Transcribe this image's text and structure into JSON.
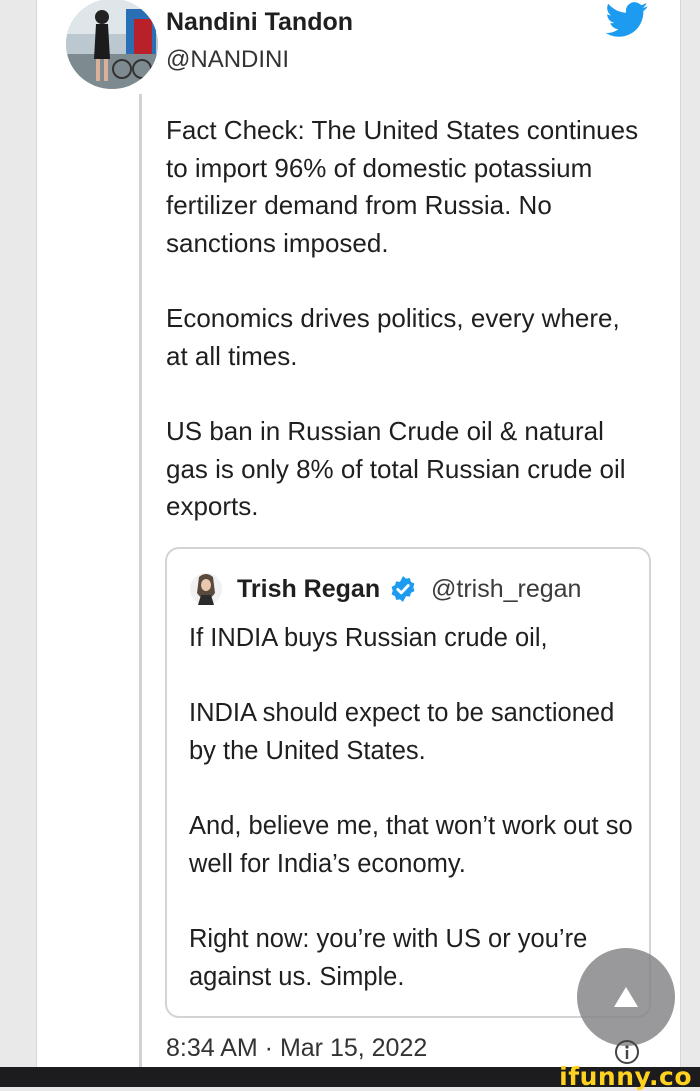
{
  "tweet": {
    "author_name": "Nandini Tandon",
    "author_handle": "@NANDINI",
    "paragraphs": [
      "Fact Check: The United States continues to import 96% of domestic potassium fertilizer demand from Russia. No sanctions imposed.",
      "Economics drives politics, every where, at all times.",
      "US ban in Russian Crude oil & natural gas is only 8% of total Russian crude oil exports."
    ],
    "timestamp": "8:34 AM · Mar 15, 2022"
  },
  "quoted_tweet": {
    "author_name": "Trish Regan",
    "author_handle": "@trish_regan",
    "paragraphs": [
      "If INDIA buys Russian crude oil,",
      "INDIA should expect to be sanctioned by the United States.",
      "And, believe me, that won’t work out so well for India’s economy.",
      "Right now: you’re with US or you’re against us. Simple."
    ]
  },
  "icons": {
    "brand": "twitter-bird-icon",
    "verified": "verified-badge-icon",
    "scroll_top": "arrow-up-icon",
    "info": "info-icon"
  },
  "colors": {
    "twitter_blue": "#1d9bf0",
    "watermark_yellow": "#ffd21f"
  },
  "watermark": "ifunny.co"
}
